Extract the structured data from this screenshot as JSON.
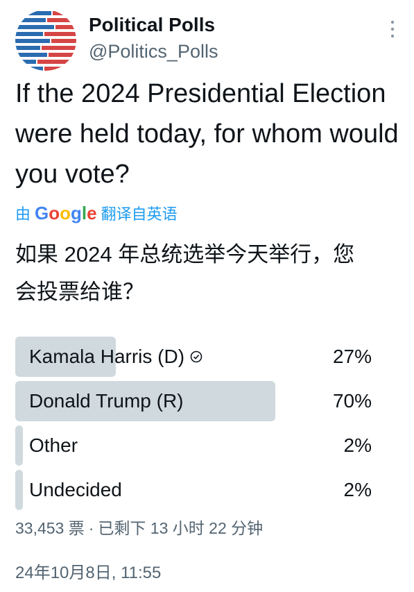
{
  "account": {
    "display_name": "Political Polls",
    "handle": "@Politics_Polls"
  },
  "tweet": {
    "question": "If the 2024 Presidential Election were held today, for whom would you vote?",
    "translate": {
      "prefix": "由",
      "provider": "Google",
      "suffix": "翻译自英语"
    },
    "translated_text": "如果 2024 年总统选举今天举行，您会投票给谁？"
  },
  "poll": {
    "options": [
      {
        "label": "Kamala Harris (D)",
        "percent_label": "27%",
        "fraction": 0.27,
        "selected": true
      },
      {
        "label": "Donald Trump (R)",
        "percent_label": "70%",
        "fraction": 0.7,
        "selected": false
      },
      {
        "label": "Other",
        "percent_label": "2%",
        "fraction": 0.02,
        "selected": false
      },
      {
        "label": "Undecided",
        "percent_label": "2%",
        "fraction": 0.02,
        "selected": false
      }
    ],
    "votes": "33,453 票",
    "separator": "·",
    "remaining": "已剩下 13 小时 22 分钟"
  },
  "timestamp": "24年10月8日, 11:55",
  "colors": {
    "bar": "#cfd9de",
    "link": "#1d9bf0",
    "secondary_text": "#536471",
    "primary_text": "#0f1419",
    "avatar_blue": "#2b6cb0",
    "avatar_red": "#d64545"
  },
  "icons": {
    "more": "vertical-ellipsis-icon",
    "selected": "check-circle-icon",
    "avatar": "striped-globe-logo"
  }
}
